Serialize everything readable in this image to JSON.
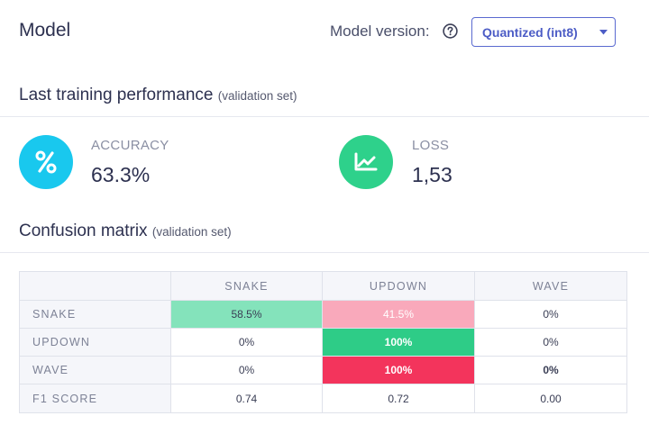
{
  "header": {
    "title": "Model",
    "version_label": "Model version:",
    "version_select": "Quantized (int8)"
  },
  "performance": {
    "title": "Last training performance",
    "subtitle": "(validation set)",
    "accuracy_label": "ACCURACY",
    "accuracy_value": "63.3%",
    "loss_label": "LOSS",
    "loss_value": "1,53"
  },
  "confusion": {
    "title": "Confusion matrix",
    "subtitle": "(validation set)",
    "columns": [
      "SNAKE",
      "UPDOWN",
      "WAVE"
    ],
    "rows": [
      {
        "label": "SNAKE",
        "cells": [
          "58.5%",
          "41.5%",
          "0%"
        ]
      },
      {
        "label": "UPDOWN",
        "cells": [
          "0%",
          "100%",
          "0%"
        ]
      },
      {
        "label": "WAVE",
        "cells": [
          "0%",
          "100%",
          "0%"
        ]
      }
    ],
    "f1_label": "F1 SCORE",
    "f1": [
      "0.74",
      "0.72",
      "0.00"
    ]
  },
  "colors": {
    "accuracy_icon": "#19c8ee",
    "loss_icon": "#2ed18b",
    "correct_strong": "#2ecc87",
    "correct_light": "#84e3bb",
    "wrong_strong": "#f3345c",
    "wrong_light": "#f9a9bb",
    "accent": "#4d5dc6"
  },
  "icons": {
    "help": "question-circle-icon",
    "caret": "caret-down-icon",
    "accuracy": "percent-icon",
    "loss": "chart-line-icon"
  }
}
